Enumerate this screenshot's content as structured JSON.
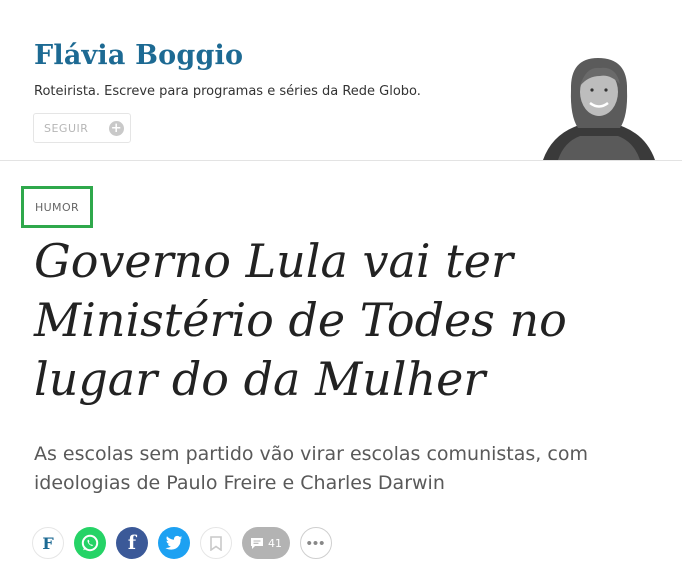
{
  "author": {
    "name": "Flávia Boggio",
    "bio": "Roteirista. Escreve para programas e séries da Rede Globo.",
    "follow_label": "SEGUIR",
    "photo": "author-portrait-bw"
  },
  "article": {
    "section": "HUMOR",
    "headline": "Governo Lula vai ter Ministério de Todes no lugar do da Mulher",
    "subhead": "As escolas sem partido vão virar escolas comunistas, com ideologias de Paulo Freire e Charles Darwin"
  },
  "share": {
    "folha_label": "F",
    "facebook_label": "f",
    "comments_count": "41",
    "icons": [
      "folha-icon",
      "whatsapp-icon",
      "facebook-icon",
      "twitter-icon",
      "bookmark-icon",
      "comment-icon",
      "more-icon"
    ]
  },
  "colors": {
    "author_name": "#1d6a93",
    "tag_highlight": "#2fa84b",
    "whatsapp": "#25d366",
    "facebook": "#3b5998",
    "twitter": "#1da1f2",
    "comments": "#b3b3b3"
  }
}
